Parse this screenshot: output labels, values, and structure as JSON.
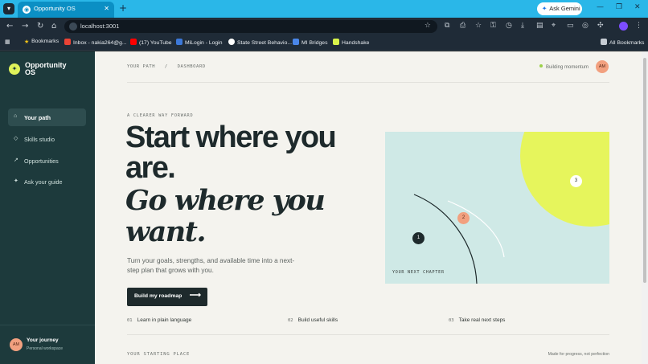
{
  "browser": {
    "tab_title": "Opportunity OS",
    "tab_close": "✕",
    "new_tab": "+",
    "url": "localhost:3001",
    "gemini_label": "Ask Gemini",
    "bookmarks": [
      {
        "label": "Bookmarks",
        "color": "#f5c518"
      },
      {
        "label": "Inbox - nakia264@g...",
        "color": "#ea4335"
      },
      {
        "label": "(17) YouTube",
        "color": "#ff0000"
      },
      {
        "label": "MiLogin - Login",
        "color": "#3c78d8"
      },
      {
        "label": "State Street Behavio...",
        "color": "#ffffff"
      },
      {
        "label": "MI Bridges",
        "color": "#4a86e8"
      },
      {
        "label": "Handshake",
        "color": "#d8f34a"
      }
    ],
    "all_bookmarks": "All Bookmarks"
  },
  "sidebar": {
    "brand": "Opportunity OS",
    "items": [
      {
        "label": "Your path",
        "icon": "home-icon",
        "glyph": "⌂",
        "active": true
      },
      {
        "label": "Skills studio",
        "icon": "diamond-icon",
        "glyph": "◇",
        "active": false
      },
      {
        "label": "Opportunities",
        "icon": "arrow-up-right-icon",
        "glyph": "↗",
        "active": false
      },
      {
        "label": "Ask your guide",
        "icon": "sparkle-icon",
        "glyph": "✦",
        "active": false
      }
    ],
    "footer": {
      "initials": "AM",
      "title": "Your journey",
      "subtitle": "Personal workspace"
    }
  },
  "header": {
    "breadcrumb": "YOUR PATH   /   DASHBOARD",
    "status": "Building momentum",
    "status_color": "#9cd14a",
    "avatar_initials": "AM"
  },
  "hero": {
    "eyebrow": "A CLEARER WAY FORWARD",
    "title_line1": "Start where you are.",
    "title_line2": "Go where you want.",
    "lede": "Turn your goals, strengths, and available time into a next-step plan that grows with you.",
    "cta_label": "Build my roadmap",
    "cta_arrow": "⟶"
  },
  "features": [
    {
      "num": "01",
      "label": "Learn in plain language"
    },
    {
      "num": "02",
      "label": "Build useful skills"
    },
    {
      "num": "03",
      "label": "Take real next steps"
    }
  ],
  "artwork": {
    "label": "YOUR NEXT CHAPTER",
    "markers": [
      "1",
      "2",
      "3"
    ],
    "colors": {
      "bg": "#cfe9e6",
      "sun": "#e6f55c",
      "peach": "#f2a07f",
      "ink": "#1e2a2c"
    }
  },
  "section": {
    "label": "YOUR STARTING PLACE",
    "note": "Made for progress, not perfection"
  }
}
